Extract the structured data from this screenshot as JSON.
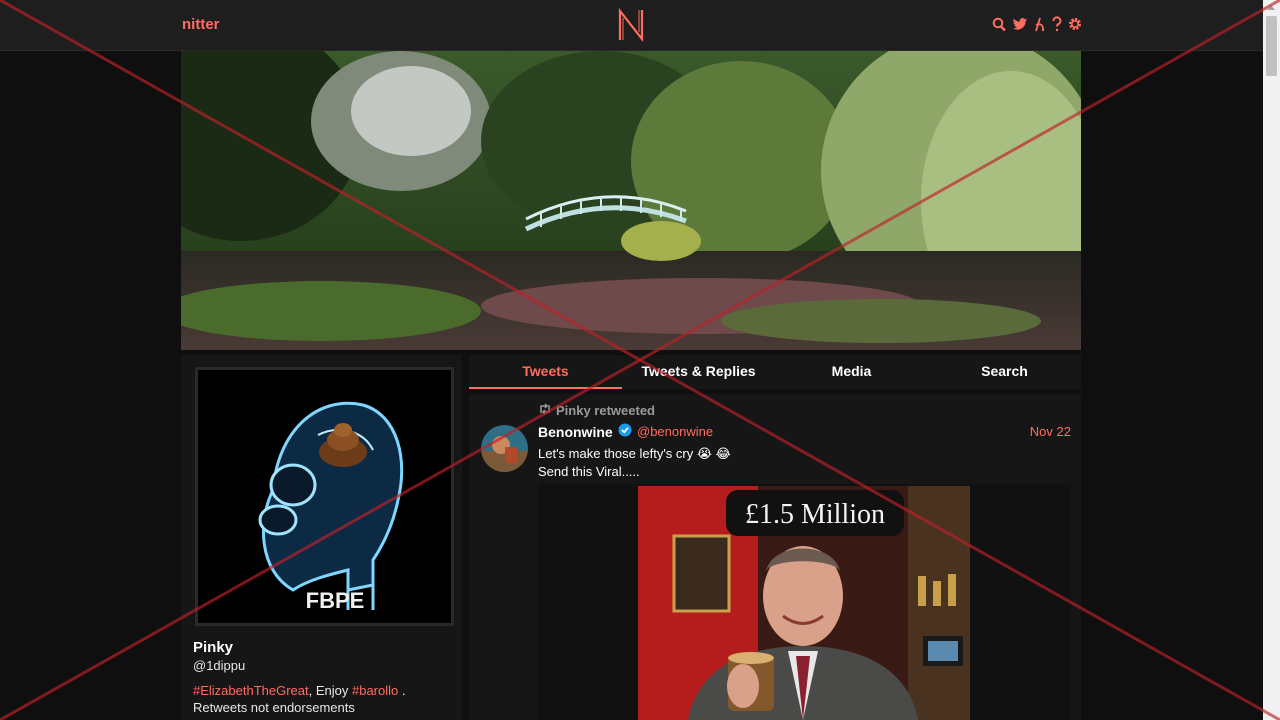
{
  "nav": {
    "brand": "nitter",
    "icons": [
      "search-icon",
      "twitter-bird-icon",
      "rss-icon",
      "help-icon",
      "gear-icon"
    ]
  },
  "profile": {
    "fullname": "Pinky",
    "username": "@1dippu",
    "avatar_caption": "FBPE",
    "bio": {
      "hashtag1": "#ElizabethTheGreat",
      "text1": ", Enjoy ",
      "hashtag2": "#barollo",
      "text2": " .",
      "line2": "Retweets not endorsements"
    }
  },
  "tabs": [
    {
      "label": "Tweets",
      "active": true
    },
    {
      "label": "Tweets & Replies",
      "active": false
    },
    {
      "label": "Media",
      "active": false
    },
    {
      "label": "Search",
      "active": false
    }
  ],
  "tweet": {
    "retweet_header": "Pinky retweeted",
    "author_name": "Benonwine",
    "author_handle": "@benonwine",
    "date": "Nov 22",
    "line1": "Let's make those lefty's cry 😭 😂",
    "line2": "Send this Viral.....",
    "media_caption": "£1.5 Million"
  },
  "colors": {
    "accent": "#ff6c60",
    "background": "#0f0f0f",
    "panel": "#161616",
    "navbar": "#1e1e1e"
  }
}
